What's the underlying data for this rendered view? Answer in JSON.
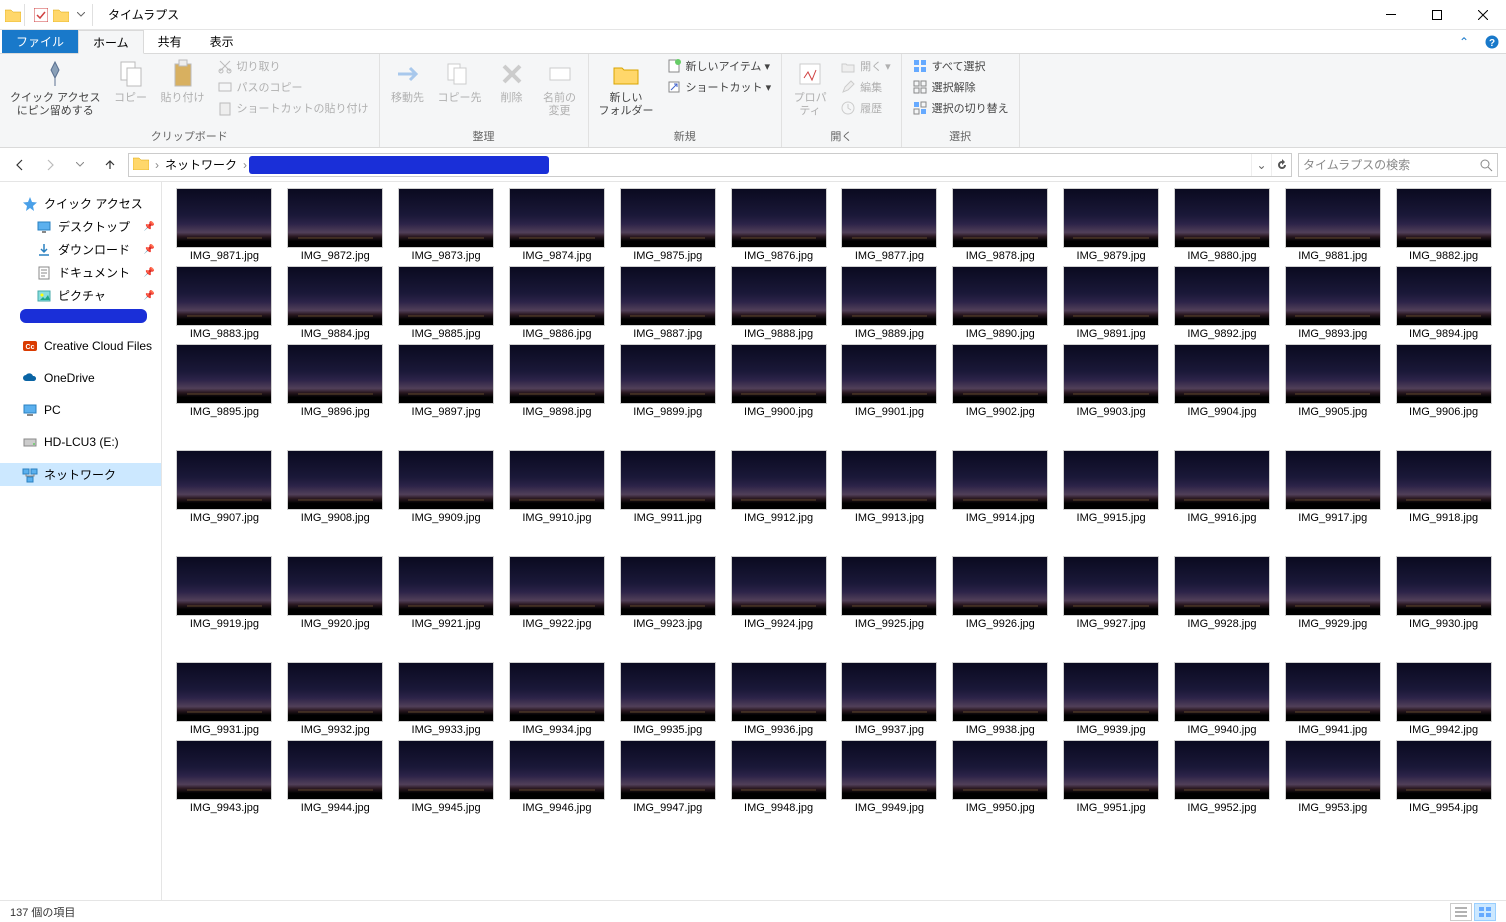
{
  "title": "タイムラプス",
  "ribbon_tabs": {
    "file": "ファイル",
    "home": "ホーム",
    "share": "共有",
    "view": "表示"
  },
  "ribbon": {
    "clipboard": {
      "label": "クリップボード",
      "pin": "クイック アクセス\nにピン留めする",
      "copy": "コピー",
      "paste": "貼り付け",
      "cut": "切り取り",
      "copy_path": "パスのコピー",
      "paste_shortcut": "ショートカットの貼り付け"
    },
    "organize": {
      "label": "整理",
      "move": "移動先",
      "copy_to": "コピー先",
      "delete": "削除",
      "rename": "名前の\n変更"
    },
    "new": {
      "label": "新規",
      "new_folder": "新しい\nフォルダー",
      "new_item": "新しいアイテム ▾",
      "shortcut": "ショートカット ▾"
    },
    "open": {
      "label": "開く",
      "properties": "プロパ\nティ",
      "open": "開く ▾",
      "edit": "編集",
      "history": "履歴"
    },
    "select": {
      "label": "選択",
      "select_all": "すべて選択",
      "deselect": "選択解除",
      "invert": "選択の切り替え"
    }
  },
  "breadcrumb": {
    "network": "ネットワーク"
  },
  "search": {
    "placeholder": "タイムラプスの検索"
  },
  "sidebar": [
    {
      "icon": "star",
      "label": "クイック アクセス",
      "color": "#4aa0e8"
    },
    {
      "icon": "desktop",
      "label": "デスクトップ",
      "pin": true,
      "indent": true
    },
    {
      "icon": "download",
      "label": "ダウンロード",
      "pin": true,
      "indent": true
    },
    {
      "icon": "doc",
      "label": "ドキュメント",
      "pin": true,
      "indent": true
    },
    {
      "icon": "picture",
      "label": "ピクチャ",
      "pin": true,
      "indent": true
    },
    {
      "redact": true
    },
    {
      "gap": true
    },
    {
      "icon": "cc",
      "label": "Creative Cloud Files"
    },
    {
      "gap": true
    },
    {
      "icon": "onedrive",
      "label": "OneDrive"
    },
    {
      "gap": true
    },
    {
      "icon": "pc",
      "label": "PC"
    },
    {
      "gap": true
    },
    {
      "icon": "disk",
      "label": "HD-LCU3 (E:)"
    },
    {
      "gap": true
    },
    {
      "icon": "network",
      "label": "ネットワーク",
      "selected": true
    }
  ],
  "files": [
    "IMG_9871.jpg",
    "IMG_9872.jpg",
    "IMG_9873.jpg",
    "IMG_9874.jpg",
    "IMG_9875.jpg",
    "IMG_9876.jpg",
    "IMG_9877.jpg",
    "IMG_9878.jpg",
    "IMG_9879.jpg",
    "IMG_9880.jpg",
    "IMG_9881.jpg",
    "IMG_9882.jpg",
    "IMG_9883.jpg",
    "IMG_9884.jpg",
    "IMG_9885.jpg",
    "IMG_9886.jpg",
    "IMG_9887.jpg",
    "IMG_9888.jpg",
    "IMG_9889.jpg",
    "IMG_9890.jpg",
    "IMG_9891.jpg",
    "IMG_9892.jpg",
    "IMG_9893.jpg",
    "IMG_9894.jpg",
    "IMG_9895.jpg",
    "IMG_9896.jpg",
    "IMG_9897.jpg",
    "IMG_9898.jpg",
    "IMG_9899.jpg",
    "IMG_9900.jpg",
    "IMG_9901.jpg",
    "IMG_9902.jpg",
    "IMG_9903.jpg",
    "IMG_9904.jpg",
    "IMG_9905.jpg",
    "IMG_9906.jpg",
    "__gap__",
    "IMG_9907.jpg",
    "IMG_9908.jpg",
    "IMG_9909.jpg",
    "IMG_9910.jpg",
    "IMG_9911.jpg",
    "IMG_9912.jpg",
    "IMG_9913.jpg",
    "IMG_9914.jpg",
    "IMG_9915.jpg",
    "IMG_9916.jpg",
    "IMG_9917.jpg",
    "IMG_9918.jpg",
    "__gap__",
    "IMG_9919.jpg",
    "IMG_9920.jpg",
    "IMG_9921.jpg",
    "IMG_9922.jpg",
    "IMG_9923.jpg",
    "IMG_9924.jpg",
    "IMG_9925.jpg",
    "IMG_9926.jpg",
    "IMG_9927.jpg",
    "IMG_9928.jpg",
    "IMG_9929.jpg",
    "IMG_9930.jpg",
    "__gap__",
    "IMG_9931.jpg",
    "IMG_9932.jpg",
    "IMG_9933.jpg",
    "IMG_9934.jpg",
    "IMG_9935.jpg",
    "IMG_9936.jpg",
    "IMG_9937.jpg",
    "IMG_9938.jpg",
    "IMG_9939.jpg",
    "IMG_9940.jpg",
    "IMG_9941.jpg",
    "IMG_9942.jpg",
    "IMG_9943.jpg",
    "IMG_9944.jpg",
    "IMG_9945.jpg",
    "IMG_9946.jpg",
    "IMG_9947.jpg",
    "IMG_9948.jpg",
    "IMG_9949.jpg",
    "IMG_9950.jpg",
    "IMG_9951.jpg",
    "IMG_9952.jpg",
    "IMG_9953.jpg",
    "IMG_9954.jpg"
  ],
  "status": "137 個の項目"
}
